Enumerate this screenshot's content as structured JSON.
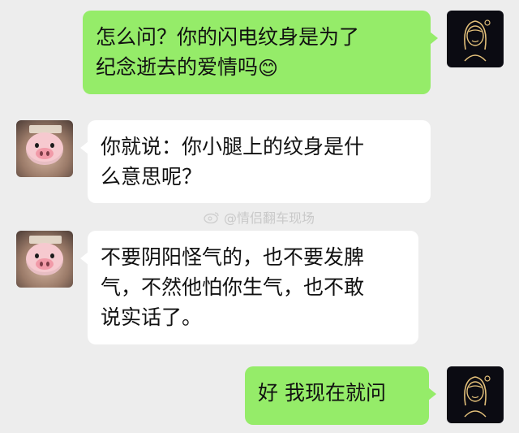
{
  "messages": [
    {
      "side": "right",
      "text": "怎么问？你的闪电纹身是为了\n纪念逝去的爱情吗",
      "emoji": "😊"
    },
    {
      "side": "left",
      "text": "你就说：你小腿上的纹身是什\n么意思呢？"
    },
    {
      "side": "left",
      "text": "不要阴阳怪气的，也不要发脾\n气，不然他怕你生气，也不敢\n说实话了。"
    },
    {
      "side": "right",
      "text": "好 我现在就问"
    }
  ],
  "watermark": {
    "text": "@情侣翻车现场",
    "icon": "weibo-icon"
  },
  "colors": {
    "background": "#ededed",
    "my_bubble": "#95ec69",
    "their_bubble": "#ffffff"
  }
}
